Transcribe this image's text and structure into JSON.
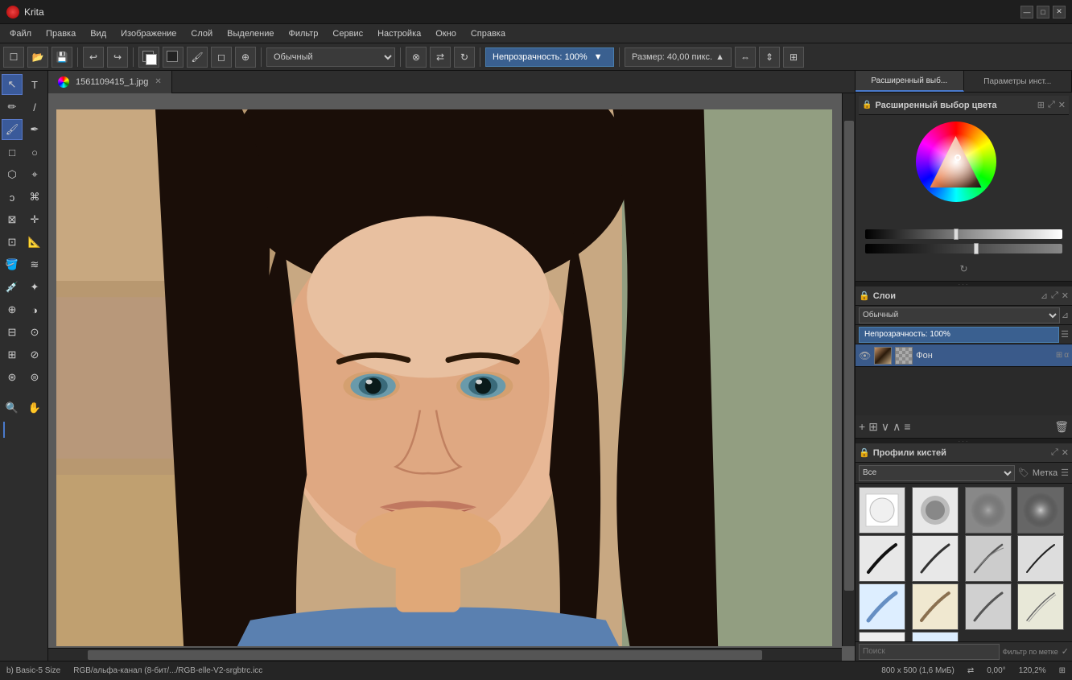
{
  "app": {
    "title": "Krita",
    "icon": "krita-logo"
  },
  "titlebar": {
    "title": "Krita",
    "minimize": "—",
    "maximize": "□",
    "close": "✕"
  },
  "menubar": {
    "items": [
      "Файл",
      "Правка",
      "Вид",
      "Изображение",
      "Слой",
      "Выделение",
      "Фильтр",
      "Сервис",
      "Настройка",
      "Окно",
      "Справка"
    ]
  },
  "toolbar": {
    "mode_label": "Обычный",
    "opacity_label": "Непрозрачность: 100%",
    "size_label": "Размер: 40,00 пикс."
  },
  "canvas": {
    "tab_title": "1561109415_1.jpg"
  },
  "color_panel": {
    "title": "Расширенный выбор цвета",
    "tab1": "Расширенный выб...",
    "tab2": "Параметры инст..."
  },
  "layers_panel": {
    "title": "Слои",
    "mode": "Обычный",
    "opacity": "Непрозрачность: 100%",
    "layer_name": "Фон"
  },
  "brush_panel": {
    "title": "Профили кистей",
    "filter_all": "Все",
    "filter_tag": "Метка",
    "search_placeholder": "Поиск",
    "filter_label": "Фильтр по метке"
  },
  "statusbar": {
    "brush": "b) Basic-5 Size",
    "color_mode": "RGB/альфа-канал (8-бит/.../RGB-elle-V2-srgbtrc.icc",
    "dimensions": "800 x 500 (1,6 МиБ)",
    "angle": "0,00°",
    "zoom": "120,2%"
  }
}
